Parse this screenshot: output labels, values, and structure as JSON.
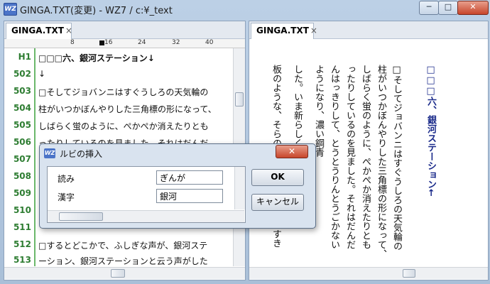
{
  "window": {
    "title": "GINGA.TXT(変更) - WZ7 / c:¥_text",
    "app_icon": "WZ",
    "min_glyph": "─",
    "max_glyph": "□",
    "close_glyph": "✕"
  },
  "left_pane": {
    "tab": {
      "label": "GINGA.TXT",
      "close": "×"
    },
    "ruler": [
      "8",
      "16",
      "24",
      "32",
      "40"
    ],
    "lines": [
      {
        "num": "H1",
        "text": "□□□六、銀河ステーション↓"
      },
      {
        "num": "502",
        "text": "↓"
      },
      {
        "num": "503",
        "text": "□そしてジョバンニはすぐうしろの天気輪の"
      },
      {
        "num": "504",
        "text": "柱がいつかぼんやりした三角標の形になって、"
      },
      {
        "num": "505",
        "text": "しばらく蛍のように、ぺかぺか消えたりとも"
      },
      {
        "num": "506",
        "text": "ったりしているのを見ました。それはだんだ"
      },
      {
        "num": "507",
        "text": ""
      },
      {
        "num": "508",
        "text": ""
      },
      {
        "num": "509",
        "text": ""
      },
      {
        "num": "510",
        "text": ""
      },
      {
        "num": "511",
        "text": ""
      },
      {
        "num": "512",
        "text": "□するとどこかで、ふしぎな声が、銀河ステ"
      },
      {
        "num": "513",
        "text": "ーション、銀河ステーションと云う声がした"
      }
    ]
  },
  "right_pane": {
    "tab": {
      "label": "GINGA.TXT",
      "close": "×"
    },
    "columns": [
      "□□□六、銀河ステーション←",
      "□そしてジョバンニはすぐうしろの天気輪の",
      "柱がいつかぼんやりした三角標の形になって、",
      "しばらく蛍のように、ぺかぺか消えたりとも",
      "ったりしているのを見ました。それはだんだ",
      "んはっきりして、とうとうりんとうごかない",
      "ようになり、濃い鋼青",
      "した。いま新らしく灼",
      "板のような、そらの野",
      "すき"
    ]
  },
  "dialog": {
    "icon": "WZ",
    "title": "ルビの挿入",
    "close_glyph": "✕",
    "rows": [
      {
        "label": "読み",
        "value": "ぎんが"
      },
      {
        "label": "漢字",
        "value": "銀河"
      }
    ],
    "ok_label": "OK",
    "cancel_label": "キャンセル"
  }
}
